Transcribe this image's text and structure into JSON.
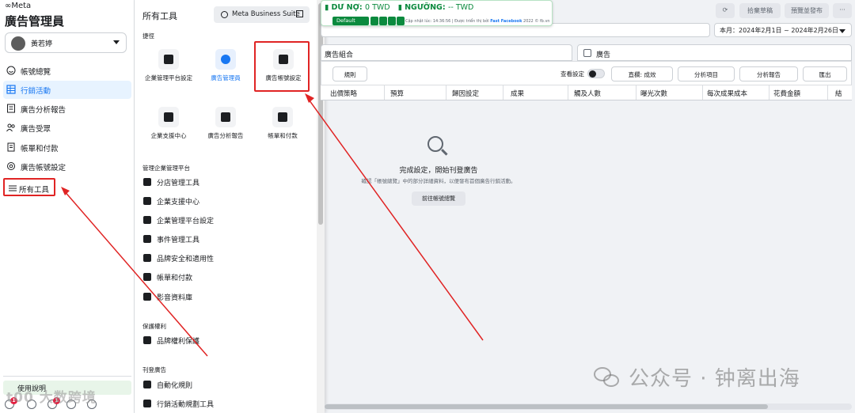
{
  "left_nav": {
    "logo": "∞Meta",
    "title": "廣告管理員",
    "account_name": "黃若婷",
    "items": [
      {
        "label": "帳號總覽",
        "icon": "smiley-icon"
      },
      {
        "label": "行銷活動",
        "icon": "grid-icon"
      },
      {
        "label": "廣告分析報告",
        "icon": "report-icon"
      },
      {
        "label": "廣告受眾",
        "icon": "people-icon"
      },
      {
        "label": "帳單和付款",
        "icon": "billing-icon"
      },
      {
        "label": "廣告帳號設定",
        "icon": "settings-icon"
      },
      {
        "label": "所有工具",
        "icon": "menu-icon"
      }
    ],
    "help": "使用說明",
    "notification_badges": [
      "1",
      "1"
    ]
  },
  "panel": {
    "title": "所有工具",
    "mbs_label": "Meta Business Suite",
    "shortcut_section": "捷徑",
    "tiles": [
      {
        "label": "企業管理平台設定",
        "icon": "gear-icon"
      },
      {
        "label": "廣告管理員",
        "icon": "ads-manager-icon"
      },
      {
        "label": "廣告帳號設定",
        "icon": "ad-account-settings-icon"
      },
      {
        "label": "企業支援中心",
        "icon": "support-icon"
      },
      {
        "label": "廣告分析報告",
        "icon": "report-icon"
      },
      {
        "label": "帳單和付款",
        "icon": "billing-icon"
      }
    ],
    "section_business": "管理企業管理平台",
    "business_items": [
      "分店管理工具",
      "企業支援中心",
      "企業管理平台設定",
      "事件管理工具",
      "品牌安全和適用性",
      "帳單和付款",
      "影音資料庫"
    ],
    "section_rights": "保護權利",
    "rights_items": [
      "品牌權利保護"
    ],
    "section_ads": "刊登廣告",
    "ads_items": [
      "自動化規則",
      "行銷活動規劃工具"
    ]
  },
  "status_banner": {
    "debt_label": "DƯ NỢ:",
    "debt_value": "0 TWD",
    "threshold_label": "NGƯỠNG:",
    "threshold_value": "-- TWD",
    "default_label": "Default",
    "footer_text": "Cập nhật lúc: 14:36:56 | Được triển thị bởi",
    "footer_brand": "Fast Facebook",
    "footer_year": "2022 © fb.vn"
  },
  "top_actions": [
    "拾棄草稿",
    "預覽並發布",
    "···"
  ],
  "date_range": "本月：2024年2月1日 ~ 2024年2月26日",
  "tabs": {
    "adset": "廣告組合",
    "ad": "廣告"
  },
  "toolbar": {
    "rules": "規則",
    "view_settings": "查看設定",
    "columns": "直欄: 成效",
    "breakdown": "分析項目",
    "reports": "分析報告",
    "export": "匯出"
  },
  "table_headers": [
    "出價策略",
    "預算",
    "歸因設定",
    "成果",
    "觸及人數",
    "曝光次數",
    "每次成果成本",
    "花費金額",
    "結"
  ],
  "empty_state": {
    "title": "完成設定，開始刊登廣告",
    "subtitle": "確認「帳號總覽」中的部分詳細資料，以便發布首個廣告行銷活動。",
    "button": "前往帳號總覽"
  },
  "watermarks": {
    "left": "t00 大数跨境",
    "right": "公众号 · 钟离出海"
  },
  "colors": {
    "accent": "#1877f2",
    "highlight_box": "#e02424",
    "banner_green": "#0b8a3e"
  }
}
